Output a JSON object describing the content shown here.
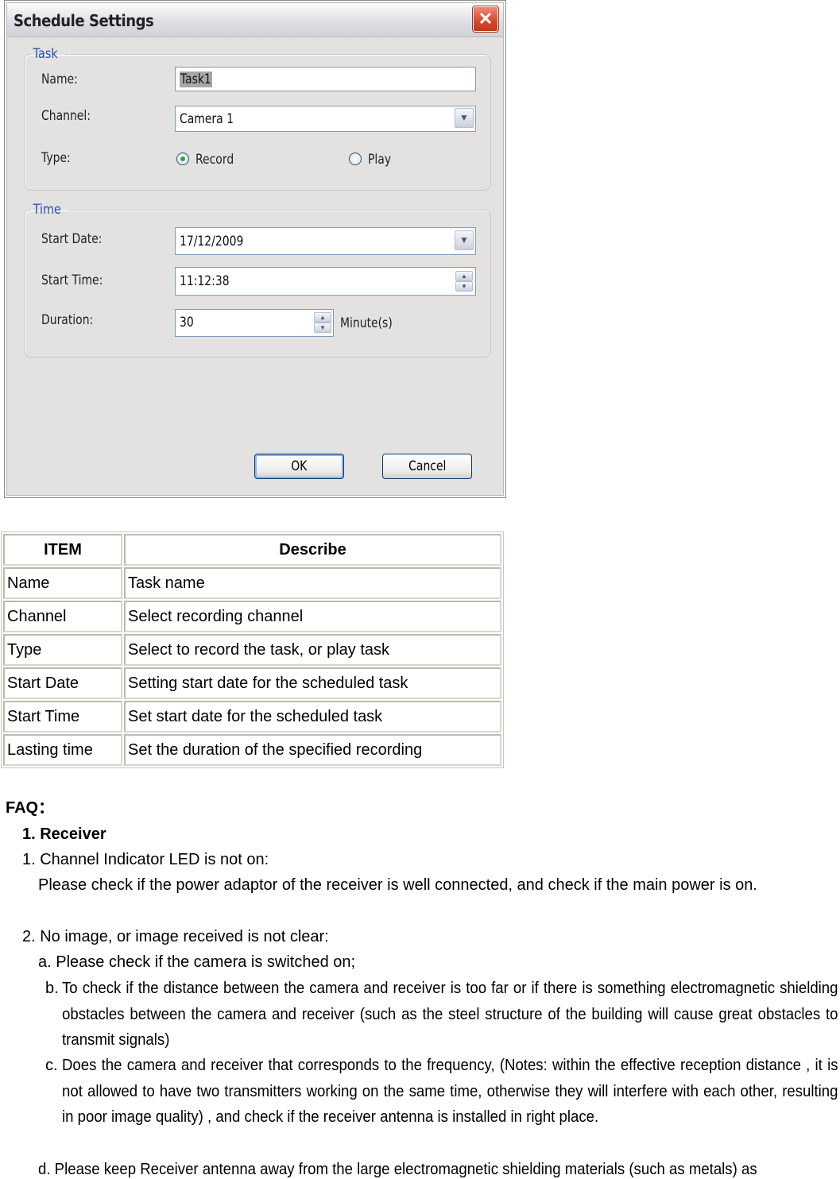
{
  "dialog": {
    "title": "Schedule Settings",
    "close_glyph": "✕",
    "task_group": {
      "legend": "Task",
      "name_label": "Name:",
      "name_value": "Task1",
      "channel_label": "Channel:",
      "channel_value": "Camera 1",
      "type_label": "Type:",
      "type_options": [
        {
          "label": "Record",
          "selected": true
        },
        {
          "label": "Play",
          "selected": false
        }
      ]
    },
    "time_group": {
      "legend": "Time",
      "start_date_label": "Start Date:",
      "start_date_value": "17/12/2009",
      "start_time_label": "Start Time:",
      "start_time_value": "11:12:38",
      "duration_label": "Duration:",
      "duration_value": "30",
      "duration_unit": "Minute(s)"
    },
    "ok_label": "OK",
    "cancel_label": "Cancel",
    "icons": {
      "dropdown": "▼",
      "spin_up": "▲",
      "spin_down": "▼"
    }
  },
  "table": {
    "headers": [
      "ITEM",
      "Describe"
    ],
    "rows": [
      [
        "Name",
        "Task name"
      ],
      [
        "Channel",
        "Select recording channel"
      ],
      [
        "Type",
        "Select to record the task, or play task"
      ],
      [
        "Start Date",
        "Setting start date for the scheduled task"
      ],
      [
        "Start Time",
        "Set start date for the scheduled task"
      ],
      [
        "Lasting time",
        "Set the duration of the specified recording"
      ]
    ]
  },
  "faq": {
    "heading": "FAQ：",
    "section": "1. Receiver",
    "q1": "1. Channel Indicator LED is not on:",
    "a1": "Please check if the power adaptor of the receiver is well connected, and check if the main power is on.",
    "q2": "2. No image, or image received is not clear:",
    "a2a": "a. Please check if the camera is switched on;",
    "a2b_lead": "b.",
    "a2b": "To check if the distance between the camera and receiver is too far or if there is something electromagnetic shielding obstacles between the camera and receiver (such as the steel structure of the building will cause great obstacles to transmit signals)",
    "a2c_lead": "c.",
    "a2c": "Does the camera and receiver that corresponds to the frequency, (Notes: within the effective reception distance , it is not allowed to have two transmitters working on the same time, otherwise they will interfere with each other, resulting in poor image quality) , and check if the receiver antenna is installed in right place.",
    "a2d": "d. Please keep Receiver antenna away from the large electromagnetic shielding materials (such as metals) as"
  }
}
